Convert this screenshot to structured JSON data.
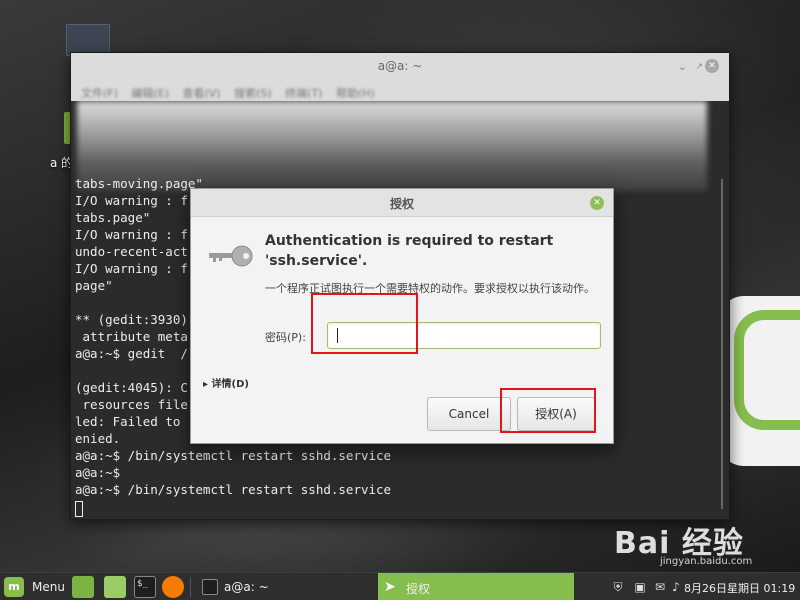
{
  "desktop": {
    "icon_label": "a 的"
  },
  "terminal": {
    "title": "a@a: ~",
    "menu": [
      "文件(F)",
      "编辑(E)",
      "查看(V)",
      "搜索(S)",
      "终端(T)",
      "帮助(H)"
    ],
    "lines": [
      "tabs-moving.page\"",
      "I/O warning : f                                            gedit/gedit-",
      "tabs.page\"",
      "I/O warning : f                                            gedit/gedit-",
      "undo-recent-act",
      "I/O warning : f                                            gedit/index.",
      "page\"",
      "",
      "** (gedit:3930)                                          led: Setting",
      " attribute meta",
      "a@a:~$ gedit  /",
      "",
      "(gedit:4045): C                                          recently used",
      " resources file                                          e parser fai",
      "led: Failed to                                          Permission d",
      "enied.",
      "a@a:~$ /bin/systemctl restart sshd.service",
      "a@a:~$",
      "a@a:~$ /bin/systemctl restart sshd.service"
    ]
  },
  "dialog": {
    "title": "授权",
    "heading": "Authentication is required to restart 'ssh.service'.",
    "description": "一个程序正试图执行一个需要特权的动作。要求授权以执行该动作。",
    "password_label": "密码(P):",
    "password_value": "",
    "details_label": "详情(D)",
    "cancel_label": "Cancel",
    "authorize_label": "授权(A)"
  },
  "watermark": {
    "text": "Bai 经验",
    "sub": "jingyan.baidu.com"
  },
  "taskbar": {
    "menu_label": "Menu",
    "tasks": [
      {
        "label": "a@a: ~"
      },
      {
        "label": "授权"
      }
    ],
    "clock": "8月26日星期日 01:19"
  },
  "colors": {
    "accent": "#86be4d",
    "highlight_box": "#e0161b"
  }
}
